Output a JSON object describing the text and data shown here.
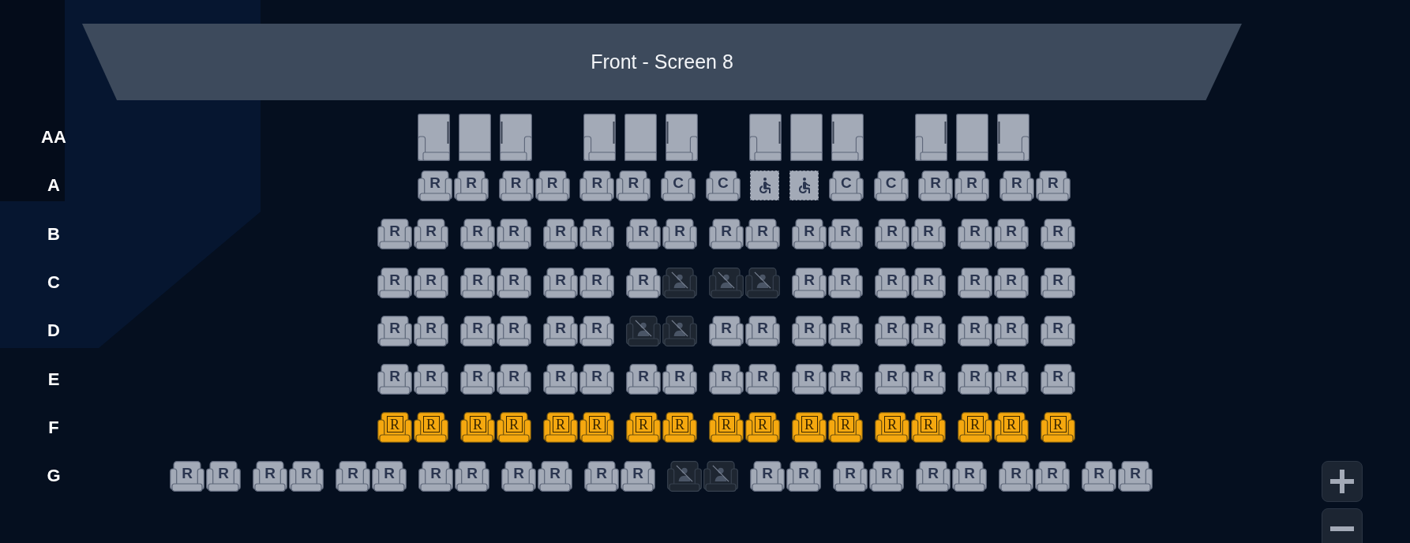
{
  "screen": {
    "label": "Front - Screen 8"
  },
  "rows": [
    {
      "label": "AA",
      "blocks": [
        [
          {
            "kind": "sofa"
          },
          {
            "kind": "sofa"
          },
          {
            "kind": "sofa"
          }
        ],
        [
          {
            "kind": "sofa"
          },
          {
            "kind": "sofa"
          },
          {
            "kind": "sofa"
          }
        ],
        [
          {
            "kind": "sofa"
          },
          {
            "kind": "sofa"
          },
          {
            "kind": "sofa"
          }
        ],
        [
          {
            "kind": "sofa"
          },
          {
            "kind": "sofa"
          },
          {
            "kind": "sofa"
          }
        ]
      ]
    },
    {
      "label": "A",
      "blocks": [
        [
          {
            "kind": "standard",
            "label": "R"
          },
          {
            "kind": "standard",
            "label": "R"
          }
        ],
        [
          {
            "kind": "standard",
            "label": "R"
          },
          {
            "kind": "standard",
            "label": "R"
          }
        ],
        [
          {
            "kind": "standard",
            "label": "R"
          },
          {
            "kind": "standard",
            "label": "R"
          }
        ],
        [
          {
            "kind": "standard",
            "label": "C"
          }
        ],
        [
          {
            "kind": "standard",
            "label": "C"
          }
        ],
        [
          {
            "kind": "wheelchair"
          }
        ],
        [
          {
            "kind": "wheelchair"
          }
        ],
        [
          {
            "kind": "standard",
            "label": "C"
          }
        ],
        [
          {
            "kind": "standard",
            "label": "C"
          }
        ],
        [
          {
            "kind": "standard",
            "label": "R"
          },
          {
            "kind": "standard",
            "label": "R"
          }
        ],
        [
          {
            "kind": "standard",
            "label": "R"
          },
          {
            "kind": "standard",
            "label": "R"
          }
        ]
      ]
    },
    {
      "label": "B",
      "blocks": [
        [
          {
            "kind": "standard",
            "label": "R"
          },
          {
            "kind": "standard",
            "label": "R"
          }
        ],
        [
          {
            "kind": "standard",
            "label": "R"
          },
          {
            "kind": "standard",
            "label": "R"
          }
        ],
        [
          {
            "kind": "standard",
            "label": "R"
          },
          {
            "kind": "standard",
            "label": "R"
          }
        ],
        [
          {
            "kind": "standard",
            "label": "R"
          },
          {
            "kind": "standard",
            "label": "R"
          }
        ],
        [
          {
            "kind": "standard",
            "label": "R"
          },
          {
            "kind": "standard",
            "label": "R"
          }
        ],
        [
          {
            "kind": "standard",
            "label": "R"
          },
          {
            "kind": "standard",
            "label": "R"
          }
        ],
        [
          {
            "kind": "standard",
            "label": "R"
          },
          {
            "kind": "standard",
            "label": "R"
          }
        ],
        [
          {
            "kind": "standard",
            "label": "R"
          },
          {
            "kind": "standard",
            "label": "R"
          }
        ],
        [
          {
            "kind": "standard",
            "label": "R"
          }
        ]
      ]
    },
    {
      "label": "C",
      "blocks": [
        [
          {
            "kind": "standard",
            "label": "R"
          },
          {
            "kind": "standard",
            "label": "R"
          }
        ],
        [
          {
            "kind": "standard",
            "label": "R"
          },
          {
            "kind": "standard",
            "label": "R"
          }
        ],
        [
          {
            "kind": "standard",
            "label": "R"
          },
          {
            "kind": "standard",
            "label": "R"
          }
        ],
        [
          {
            "kind": "standard",
            "label": "R"
          },
          {
            "kind": "blocked"
          }
        ],
        [
          {
            "kind": "blocked"
          },
          {
            "kind": "blocked"
          }
        ],
        [
          {
            "kind": "standard",
            "label": "R"
          },
          {
            "kind": "standard",
            "label": "R"
          }
        ],
        [
          {
            "kind": "standard",
            "label": "R"
          },
          {
            "kind": "standard",
            "label": "R"
          }
        ],
        [
          {
            "kind": "standard",
            "label": "R"
          },
          {
            "kind": "standard",
            "label": "R"
          }
        ],
        [
          {
            "kind": "standard",
            "label": "R"
          }
        ]
      ]
    },
    {
      "label": "D",
      "blocks": [
        [
          {
            "kind": "standard",
            "label": "R"
          },
          {
            "kind": "standard",
            "label": "R"
          }
        ],
        [
          {
            "kind": "standard",
            "label": "R"
          },
          {
            "kind": "standard",
            "label": "R"
          }
        ],
        [
          {
            "kind": "standard",
            "label": "R"
          },
          {
            "kind": "standard",
            "label": "R"
          }
        ],
        [
          {
            "kind": "blocked"
          },
          {
            "kind": "blocked"
          }
        ],
        [
          {
            "kind": "standard",
            "label": "R"
          },
          {
            "kind": "standard",
            "label": "R"
          }
        ],
        [
          {
            "kind": "standard",
            "label": "R"
          },
          {
            "kind": "standard",
            "label": "R"
          }
        ],
        [
          {
            "kind": "standard",
            "label": "R"
          },
          {
            "kind": "standard",
            "label": "R"
          }
        ],
        [
          {
            "kind": "standard",
            "label": "R"
          },
          {
            "kind": "standard",
            "label": "R"
          }
        ],
        [
          {
            "kind": "standard",
            "label": "R"
          }
        ]
      ]
    },
    {
      "label": "E",
      "blocks": [
        [
          {
            "kind": "standard",
            "label": "R"
          },
          {
            "kind": "standard",
            "label": "R"
          }
        ],
        [
          {
            "kind": "standard",
            "label": "R"
          },
          {
            "kind": "standard",
            "label": "R"
          }
        ],
        [
          {
            "kind": "standard",
            "label": "R"
          },
          {
            "kind": "standard",
            "label": "R"
          }
        ],
        [
          {
            "kind": "standard",
            "label": "R"
          },
          {
            "kind": "standard",
            "label": "R"
          }
        ],
        [
          {
            "kind": "standard",
            "label": "R"
          },
          {
            "kind": "standard",
            "label": "R"
          }
        ],
        [
          {
            "kind": "standard",
            "label": "R"
          },
          {
            "kind": "standard",
            "label": "R"
          }
        ],
        [
          {
            "kind": "standard",
            "label": "R"
          },
          {
            "kind": "standard",
            "label": "R"
          }
        ],
        [
          {
            "kind": "standard",
            "label": "R"
          },
          {
            "kind": "standard",
            "label": "R"
          }
        ],
        [
          {
            "kind": "standard",
            "label": "R"
          }
        ]
      ]
    },
    {
      "label": "F",
      "blocks": [
        [
          {
            "kind": "premium",
            "label": "R"
          },
          {
            "kind": "premium",
            "label": "R"
          }
        ],
        [
          {
            "kind": "premium",
            "label": "R"
          },
          {
            "kind": "premium",
            "label": "R"
          }
        ],
        [
          {
            "kind": "premium",
            "label": "R"
          },
          {
            "kind": "premium",
            "label": "R"
          }
        ],
        [
          {
            "kind": "premium",
            "label": "R"
          },
          {
            "kind": "premium",
            "label": "R"
          }
        ],
        [
          {
            "kind": "premium",
            "label": "R"
          },
          {
            "kind": "premium",
            "label": "R"
          }
        ],
        [
          {
            "kind": "premium",
            "label": "R"
          },
          {
            "kind": "premium",
            "label": "R"
          }
        ],
        [
          {
            "kind": "premium",
            "label": "R"
          },
          {
            "kind": "premium",
            "label": "R"
          }
        ],
        [
          {
            "kind": "premium",
            "label": "R"
          },
          {
            "kind": "premium",
            "label": "R"
          }
        ],
        [
          {
            "kind": "premium",
            "label": "R"
          }
        ]
      ]
    },
    {
      "label": "G",
      "blocks": [
        [
          {
            "kind": "standard",
            "label": "R"
          },
          {
            "kind": "standard",
            "label": "R"
          }
        ],
        [
          {
            "kind": "standard",
            "label": "R"
          },
          {
            "kind": "standard",
            "label": "R"
          }
        ],
        [
          {
            "kind": "standard",
            "label": "R"
          },
          {
            "kind": "standard",
            "label": "R"
          }
        ],
        [
          {
            "kind": "standard",
            "label": "R"
          },
          {
            "kind": "standard",
            "label": "R"
          }
        ],
        [
          {
            "kind": "standard",
            "label": "R"
          },
          {
            "kind": "standard",
            "label": "R"
          }
        ],
        [
          {
            "kind": "standard",
            "label": "R"
          },
          {
            "kind": "standard",
            "label": "R"
          }
        ],
        [
          {
            "kind": "blocked"
          },
          {
            "kind": "blocked"
          }
        ],
        [
          {
            "kind": "standard",
            "label": "R"
          },
          {
            "kind": "standard",
            "label": "R"
          }
        ],
        [
          {
            "kind": "standard",
            "label": "R"
          },
          {
            "kind": "standard",
            "label": "R"
          }
        ],
        [
          {
            "kind": "standard",
            "label": "R"
          },
          {
            "kind": "standard",
            "label": "R"
          }
        ],
        [
          {
            "kind": "standard",
            "label": "R"
          },
          {
            "kind": "standard",
            "label": "R"
          }
        ],
        [
          {
            "kind": "standard",
            "label": "R"
          },
          {
            "kind": "standard",
            "label": "R"
          }
        ]
      ]
    }
  ]
}
